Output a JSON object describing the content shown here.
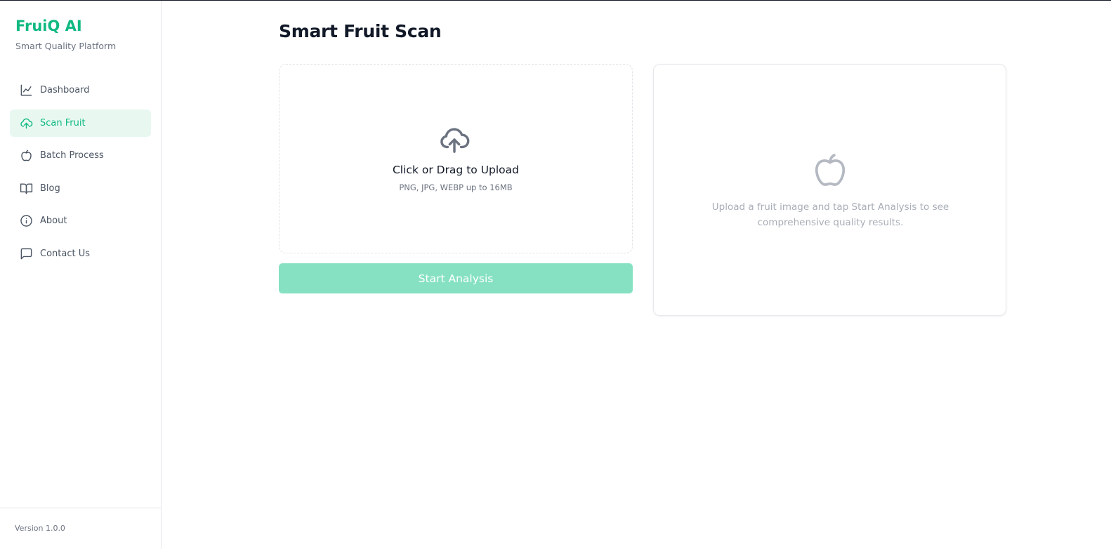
{
  "brand": {
    "title": "FruiQ AI",
    "subtitle": "Smart Quality Platform"
  },
  "nav": {
    "items": [
      {
        "label": "Dashboard",
        "icon": "chart-line-icon",
        "active": false
      },
      {
        "label": "Scan Fruit",
        "icon": "cloud-upload-icon",
        "active": true
      },
      {
        "label": "Batch Process",
        "icon": "apple-icon",
        "active": false
      },
      {
        "label": "Blog",
        "icon": "book-open-icon",
        "active": false
      },
      {
        "label": "About",
        "icon": "info-icon",
        "active": false
      },
      {
        "label": "Contact Us",
        "icon": "message-square-icon",
        "active": false
      }
    ]
  },
  "footer": {
    "version": "Version 1.0.0"
  },
  "main": {
    "title": "Smart Fruit Scan",
    "upload": {
      "title": "Click or Drag to Upload",
      "hint": "PNG, JPG, WEBP up to 16MB",
      "icon": "cloud-upload-icon"
    },
    "start_button": "Start Analysis",
    "results": {
      "icon": "apple-icon",
      "message": "Upload a fruit image and tap Start Analysis to see comprehensive quality results."
    }
  },
  "colors": {
    "accent": "#10b981",
    "accent_light_bg": "#e8f8f1",
    "button_disabled": "#86e1c3",
    "text_primary": "#111827",
    "text_muted": "#6b7280",
    "border": "#e5e7eb"
  }
}
